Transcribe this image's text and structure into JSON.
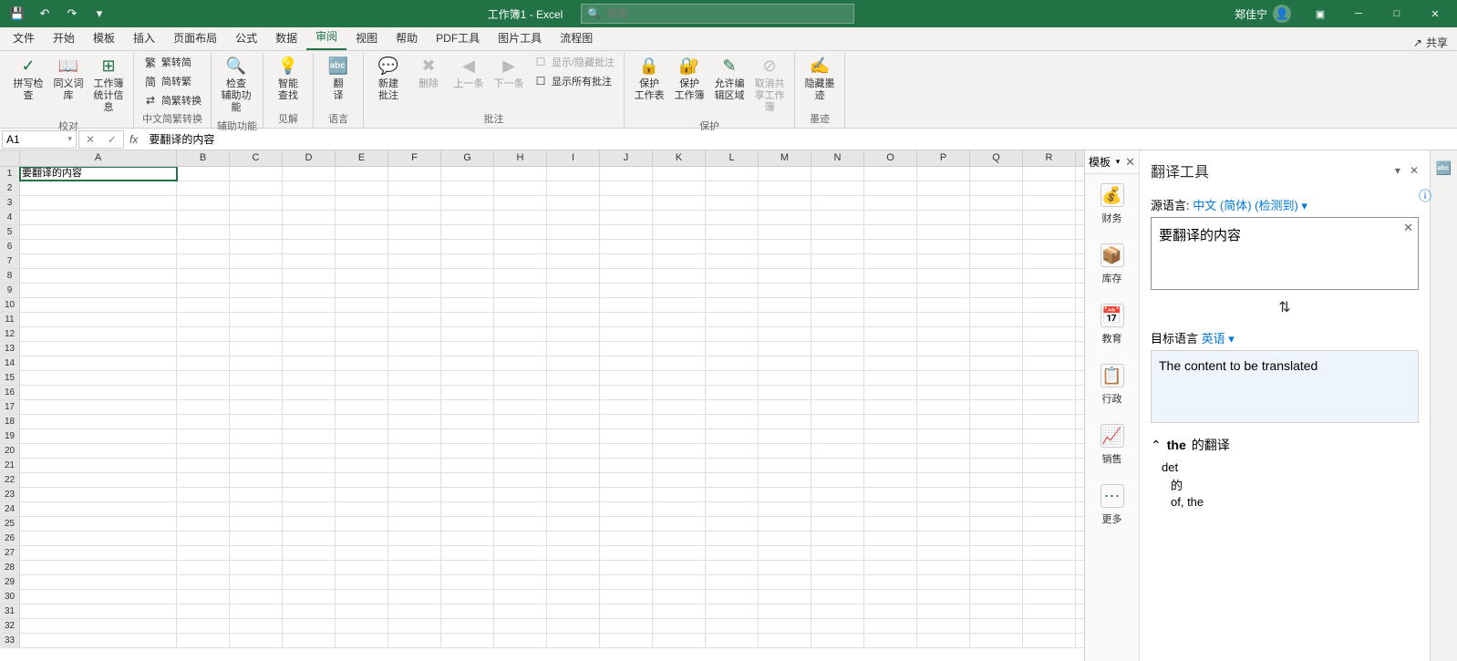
{
  "title_bar": {
    "doc_title": "工作簿1 - Excel",
    "search_placeholder": "搜索",
    "user_name": "郑佳宁"
  },
  "tabs": {
    "items": [
      "文件",
      "开始",
      "模板",
      "插入",
      "页面布局",
      "公式",
      "数据",
      "审阅",
      "视图",
      "帮助",
      "PDF工具",
      "图片工具",
      "流程图"
    ],
    "active_index": 7,
    "share": "共享"
  },
  "ribbon": {
    "groups": [
      {
        "label": "校对",
        "big": [
          {
            "icon": "✓",
            "label": "拼写检查"
          },
          {
            "icon": "📖",
            "label": "同义词库"
          },
          {
            "icon": "⊞",
            "label": "工作簿\n统计信息"
          }
        ]
      },
      {
        "label": "中文简繁转换",
        "small": [
          {
            "icon": "繁",
            "label": "繁转简"
          },
          {
            "icon": "简",
            "label": "简转繁"
          },
          {
            "icon": "⇄",
            "label": "简繁转换"
          }
        ]
      },
      {
        "label": "辅助功能",
        "big": [
          {
            "icon": "🔍",
            "label": "检查\n辅助功能"
          }
        ]
      },
      {
        "label": "见解",
        "big": [
          {
            "icon": "💡",
            "label": "智能\n查找"
          }
        ]
      },
      {
        "label": "语言",
        "big": [
          {
            "icon": "🔤",
            "label": "翻\n译"
          }
        ]
      },
      {
        "label": "批注",
        "big": [
          {
            "icon": "💬",
            "label": "新建\n批注"
          },
          {
            "icon": "✖",
            "label": "删除",
            "disabled": true
          },
          {
            "icon": "◀",
            "label": "上一条",
            "disabled": true
          },
          {
            "icon": "▶",
            "label": "下一条",
            "disabled": true
          }
        ],
        "small": [
          {
            "icon": "☐",
            "label": "显示/隐藏批注",
            "disabled": true
          },
          {
            "icon": "☐",
            "label": "显示所有批注"
          }
        ]
      },
      {
        "label": "保护",
        "big": [
          {
            "icon": "🔒",
            "label": "保护\n工作表"
          },
          {
            "icon": "🔐",
            "label": "保护\n工作簿"
          },
          {
            "icon": "✎",
            "label": "允许编\n辑区域"
          },
          {
            "icon": "⊘",
            "label": "取消共\n享工作簿",
            "disabled": true
          }
        ]
      },
      {
        "label": "墨迹",
        "big": [
          {
            "icon": "✍",
            "label": "隐藏墨\n迹"
          }
        ]
      }
    ]
  },
  "formula_bar": {
    "name_box": "A1",
    "formula": "要翻译的内容"
  },
  "sheet": {
    "columns": [
      "A",
      "B",
      "C",
      "D",
      "E",
      "F",
      "G",
      "H",
      "I",
      "J",
      "K",
      "L",
      "M",
      "N",
      "O",
      "P",
      "Q",
      "R"
    ],
    "active_cell": {
      "row": 1,
      "col": 0,
      "value": "要翻译的内容"
    },
    "row_count": 33
  },
  "template_sidebar": {
    "title": "模板",
    "items": [
      {
        "icon": "💰",
        "label": "财务"
      },
      {
        "icon": "📦",
        "label": "库存"
      },
      {
        "icon": "📅",
        "label": "教育"
      },
      {
        "icon": "📋",
        "label": "行政"
      },
      {
        "icon": "📈",
        "label": "销售"
      },
      {
        "icon": "⋯",
        "label": "更多"
      }
    ]
  },
  "translator": {
    "title": "翻译工具",
    "source_lang_label": "源语言:",
    "source_lang": "中文 (简体) (检测到)",
    "source_text": "要翻译的内容",
    "target_lang_label": "目标语言",
    "target_lang": "英语",
    "translated_text": "The content to be translated",
    "dict": {
      "header_word": "the",
      "header_suffix": "的翻译",
      "pos": "det",
      "def1": "的",
      "def2": "of, the"
    }
  }
}
